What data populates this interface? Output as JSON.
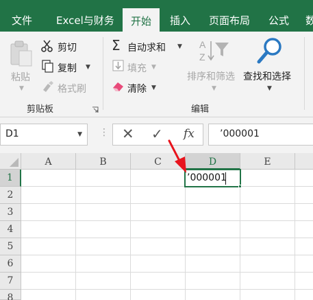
{
  "tabs": [
    {
      "label": "文件",
      "active": false
    },
    {
      "label": "Excel与财务",
      "active": false
    },
    {
      "label": "开始",
      "active": true
    },
    {
      "label": "插入",
      "active": false
    },
    {
      "label": "页面布局",
      "active": false
    },
    {
      "label": "公式",
      "active": false
    },
    {
      "label": "数",
      "active": false
    }
  ],
  "clipboard": {
    "paste": "粘贴",
    "cut": "剪切",
    "copy": "复制",
    "format_painter": "格式刷",
    "group_label": "剪贴板"
  },
  "editing": {
    "autosum": "自动求和",
    "fill": "填充",
    "clear": "清除",
    "sort_filter": "排序和筛选",
    "find_select": "查找和选择",
    "group_label": "编辑"
  },
  "formula_bar": {
    "name_box": "D1",
    "fx": "fx",
    "formula": "’000001"
  },
  "sheet": {
    "columns": [
      "A",
      "B",
      "C",
      "D",
      "E"
    ],
    "rows": [
      "1",
      "2",
      "3",
      "4",
      "5",
      "6",
      "7",
      "8"
    ],
    "selected_column": "D",
    "selected_row": "1",
    "active_cell_text": "’000001"
  },
  "colors": {
    "accent": "#217346",
    "arrow": "#e8141d",
    "eraser": "#e84a7a",
    "find_icon": "#2b79c2"
  }
}
